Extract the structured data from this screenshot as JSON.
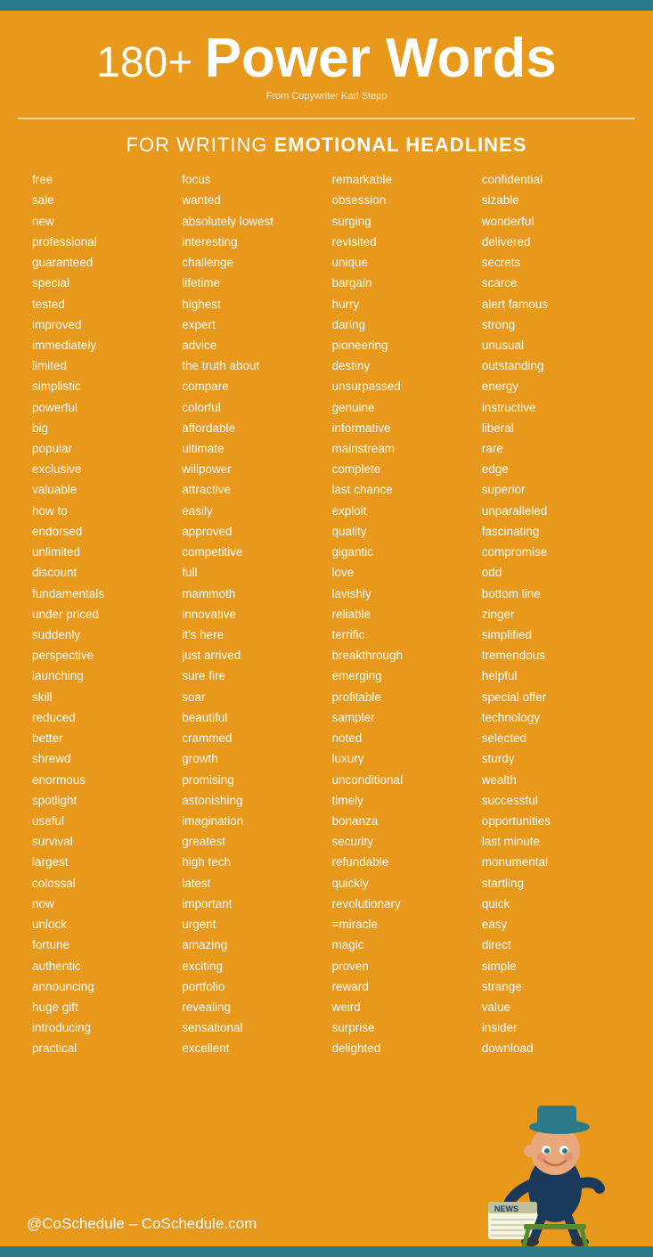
{
  "topBar": {
    "color": "#2B7A8A"
  },
  "header": {
    "titlePrefix": "180+",
    "titleMain": "Power Words",
    "attribution": "From Copywriter Karl Stepp",
    "subheading": "FOR WRITING ",
    "subheadingBold": "EMOTIONAL HEADLINES"
  },
  "columns": [
    {
      "words": [
        "free",
        "sale",
        "new",
        "professional",
        "guaranteed",
        "special",
        "tested",
        "improved",
        "immediately",
        "limited",
        "simplistic",
        "powerful",
        "big",
        "popular",
        "exclusive",
        "valuable",
        "how to",
        "endorsed",
        "unlimited",
        "discount",
        "fundamentals",
        "under priced",
        "suddenly",
        "perspective",
        "launching",
        "skill",
        "reduced",
        "better",
        "shrewd",
        "enormous",
        "spotlight",
        "useful",
        "survival",
        "largest",
        "colossal",
        "now",
        "unlock",
        "fortune",
        "authentic",
        "announcing",
        "huge gift",
        "introducing",
        "practical"
      ]
    },
    {
      "words": [
        "focus",
        "wanted",
        "absolutely lowest",
        "interesting",
        "challenge",
        "lifetime",
        "highest",
        "expert",
        "advice",
        "the truth about",
        "compare",
        "colorful",
        "affordable",
        "ultimate",
        "willpower",
        "attractive",
        "easily",
        "approved",
        "competitive",
        "full",
        "mammoth",
        "innovative",
        "it's here",
        "just arrived",
        "sure fire",
        "soar",
        "beautiful",
        "crammed",
        "growth",
        "promising",
        "astonishing",
        "imagination",
        "greatest",
        "high tech",
        "latest",
        "important",
        "urgent",
        "amazing",
        "exciting",
        "portfolio",
        "revealing",
        "sensational",
        "excellent"
      ]
    },
    {
      "words": [
        "remarkable",
        "obsession",
        "surging",
        "revisited",
        "unique",
        "bargain",
        "hurry",
        "daring",
        "pioneering",
        "destiny",
        "unsurpassed",
        "genuine",
        "informative",
        "mainstream",
        "complete",
        "last chance",
        "exploit",
        "quality",
        "gigantic",
        "love",
        "lavishly",
        "reliable",
        "terrific",
        "breakthrough",
        "emerging",
        "profitable",
        "sampler",
        "noted",
        "luxury",
        "unconditional",
        "timely",
        "bonanza",
        "security",
        "refundable",
        "quickly",
        "revolutionary",
        "=miracle",
        "magic",
        "proven",
        "reward",
        "weird",
        "surprise",
        "delighted"
      ]
    },
    {
      "words": [
        "confidential",
        "sizable",
        "wonderful",
        "delivered",
        "secrets",
        "scarce",
        "alert famous",
        "strong",
        "unusual",
        "outstanding",
        "energy",
        "instructive",
        "liberal",
        "rare",
        "edge",
        "superior",
        "unparalleled",
        "fascinating",
        "compromise",
        "odd",
        "bottom line",
        "zinger",
        "simplified",
        "tremendous",
        "helpful",
        "special offer",
        "technology",
        "selected",
        "sturdy",
        "wealth",
        "successful",
        "opportunities",
        "last minute",
        "monumental",
        "startling",
        "quick",
        "easy",
        "direct",
        "simple",
        "strange",
        "value",
        "insider",
        "download"
      ]
    }
  ],
  "footer": {
    "text": "@CoSchedule – CoSchedule.com"
  }
}
